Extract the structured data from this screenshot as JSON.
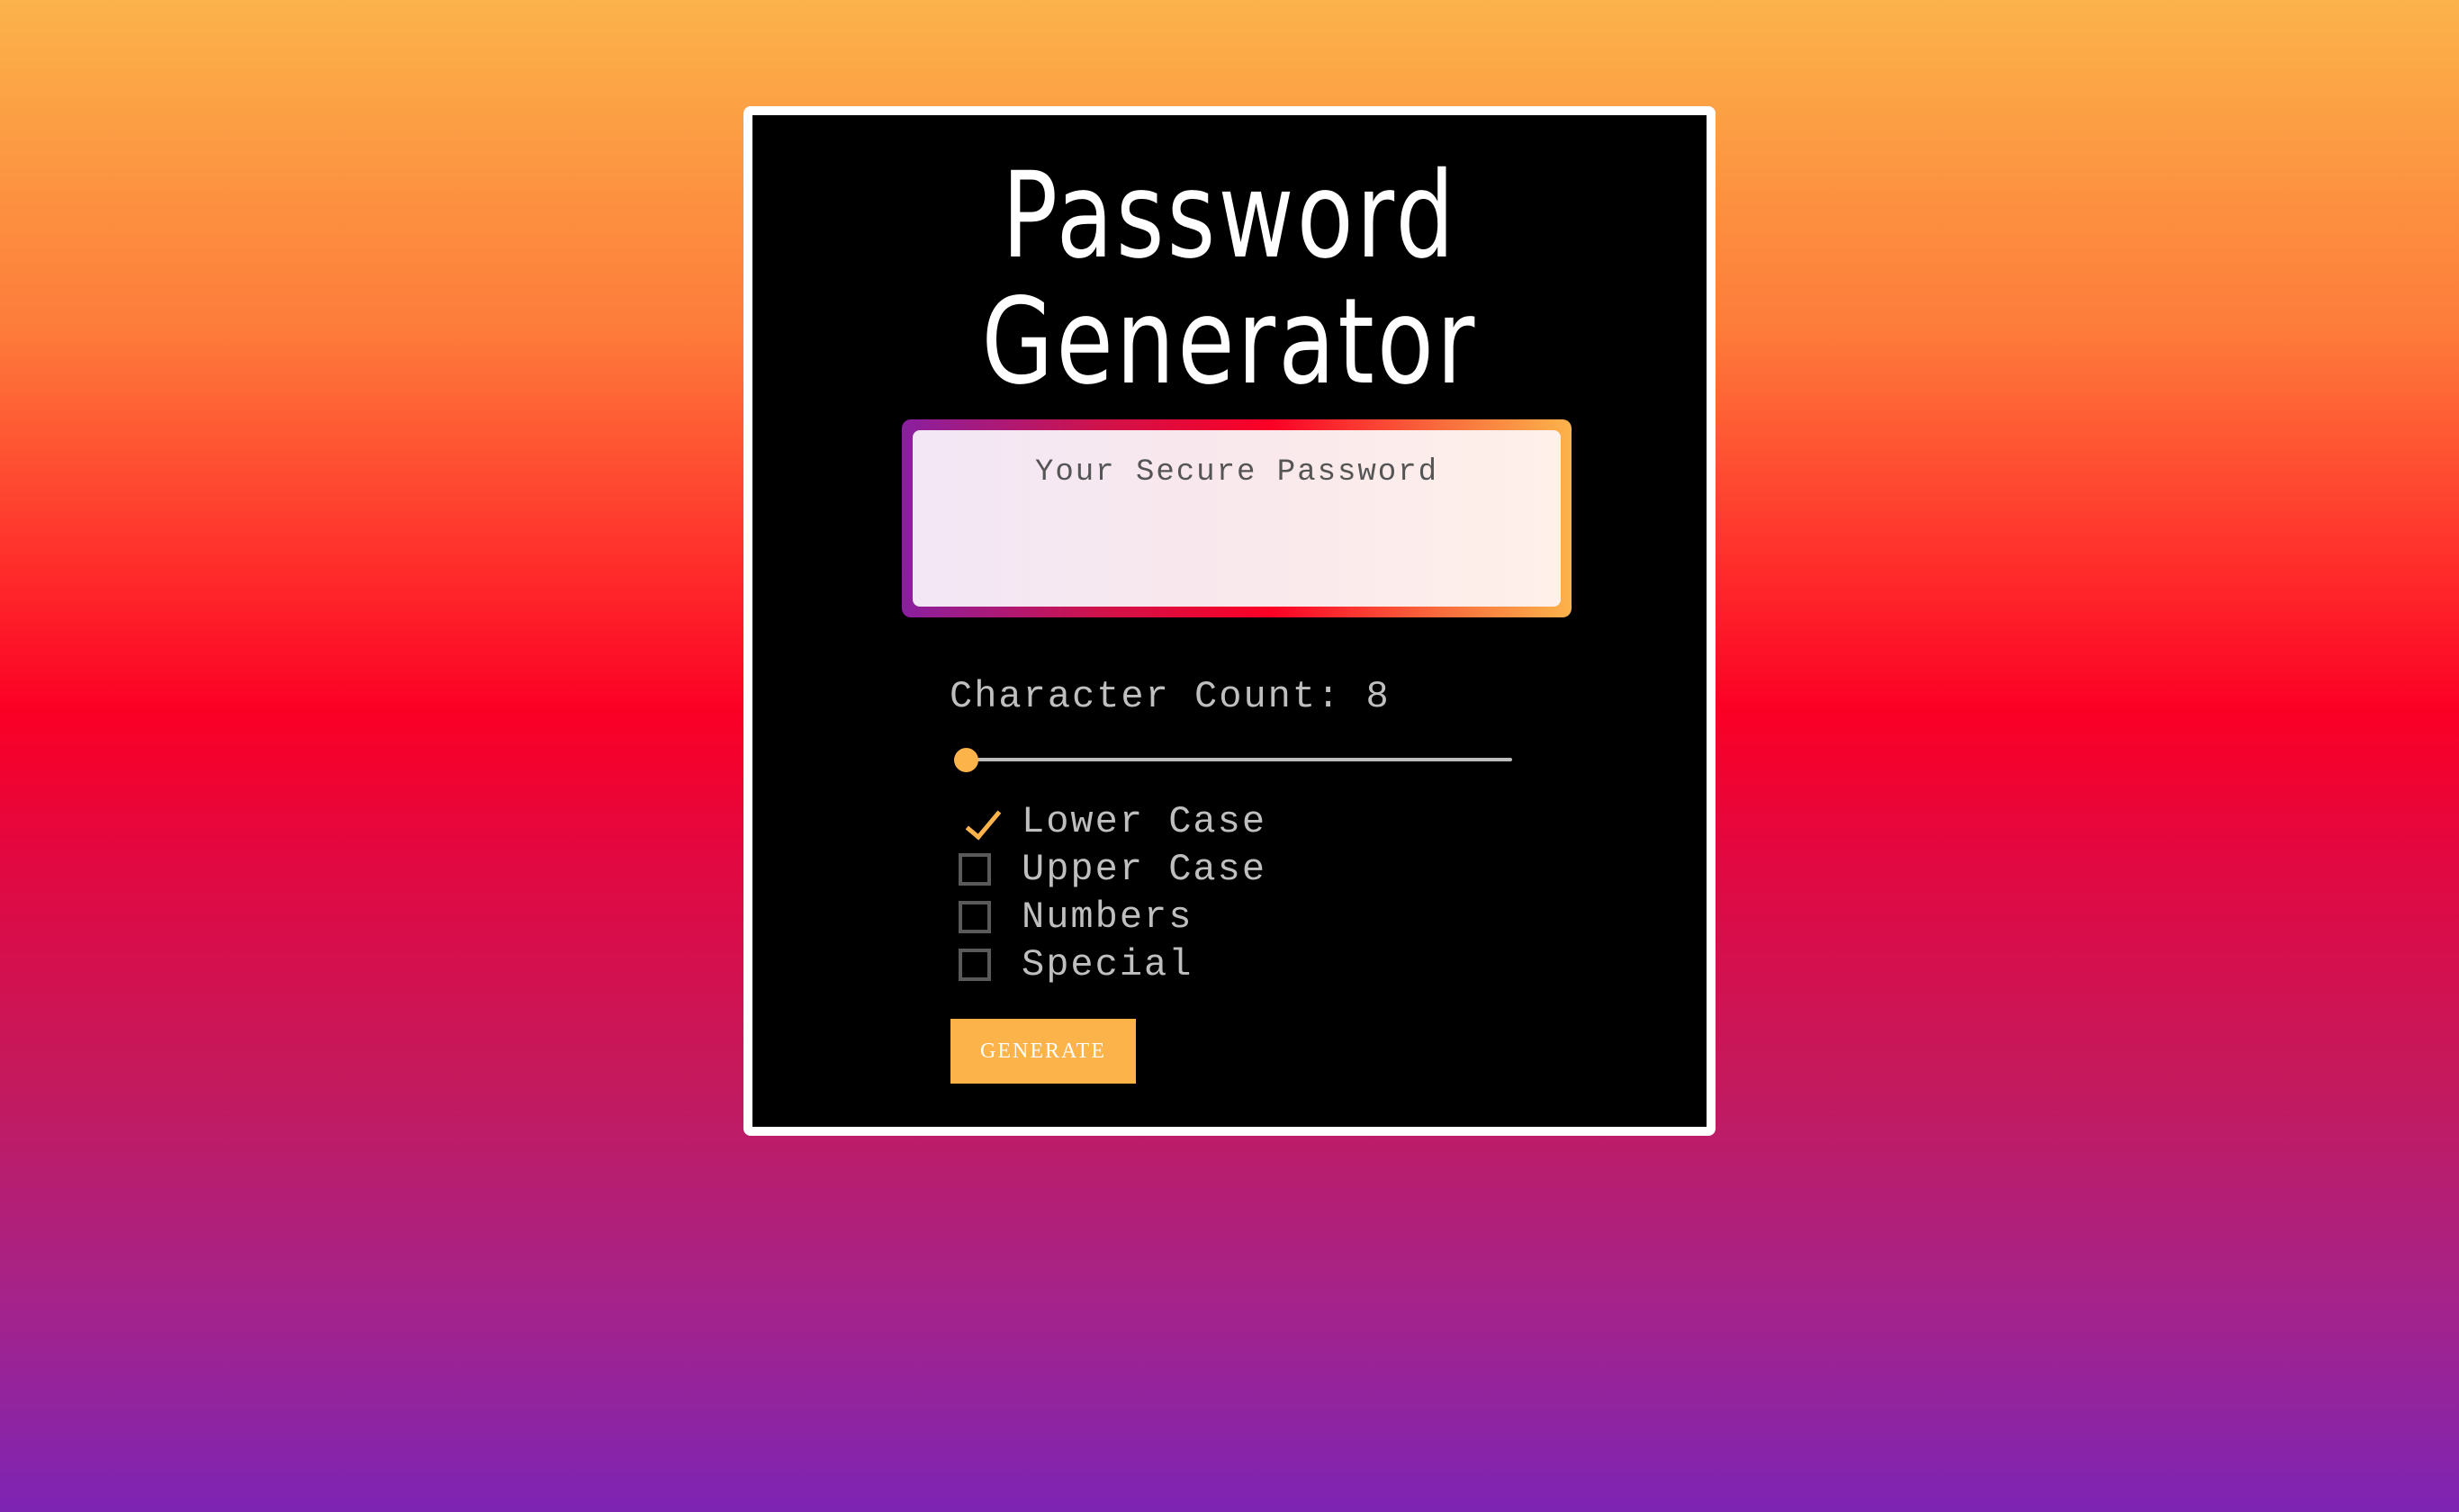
{
  "app": {
    "title_line1": "Password",
    "title_line2": "Generator"
  },
  "password": {
    "placeholder": "Your Secure Password",
    "value": ""
  },
  "count": {
    "label": "Character Count:",
    "value": "8",
    "slider_fraction": 0.0
  },
  "options": [
    {
      "label": "Lower Case",
      "checked": true
    },
    {
      "label": "Upper Case",
      "checked": false
    },
    {
      "label": "Numbers",
      "checked": false
    },
    {
      "label": "Special",
      "checked": false
    }
  ],
  "generate_button": {
    "label": "GENERATE"
  },
  "colors": {
    "accent": "#fcb34a",
    "card_bg": "#000000",
    "card_border": "#ffffff",
    "text_muted": "#bfbfbf"
  },
  "icons": {
    "checked": "checkmark-icon",
    "unchecked": "empty-checkbox-icon"
  }
}
